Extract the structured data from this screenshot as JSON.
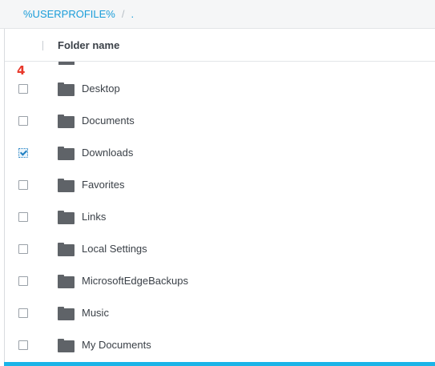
{
  "breadcrumb": {
    "root": "%USERPROFILE%",
    "separator": "/",
    "current": "."
  },
  "list": {
    "header_label": "Folder name",
    "badge": "4",
    "items": [
      {
        "label": "Desktop",
        "checked": false,
        "icon": "folder-icon"
      },
      {
        "label": "Documents",
        "checked": false,
        "icon": "folder-icon"
      },
      {
        "label": "Downloads",
        "checked": true,
        "icon": "folder-icon"
      },
      {
        "label": "Favorites",
        "checked": false,
        "icon": "folder-icon"
      },
      {
        "label": "Links",
        "checked": false,
        "icon": "folder-icon"
      },
      {
        "label": "Local Settings",
        "checked": false,
        "icon": "folder-icon"
      },
      {
        "label": "MicrosoftEdgeBackups",
        "checked": false,
        "icon": "folder-icon"
      },
      {
        "label": "Music",
        "checked": false,
        "icon": "folder-icon"
      },
      {
        "label": "My Documents",
        "checked": false,
        "icon": "folder-icon"
      }
    ]
  },
  "colors": {
    "accent": "#1a9dd9",
    "folder": "#5f6368",
    "badge": "#e8392b",
    "bottom_bar": "#1ab4e8"
  }
}
